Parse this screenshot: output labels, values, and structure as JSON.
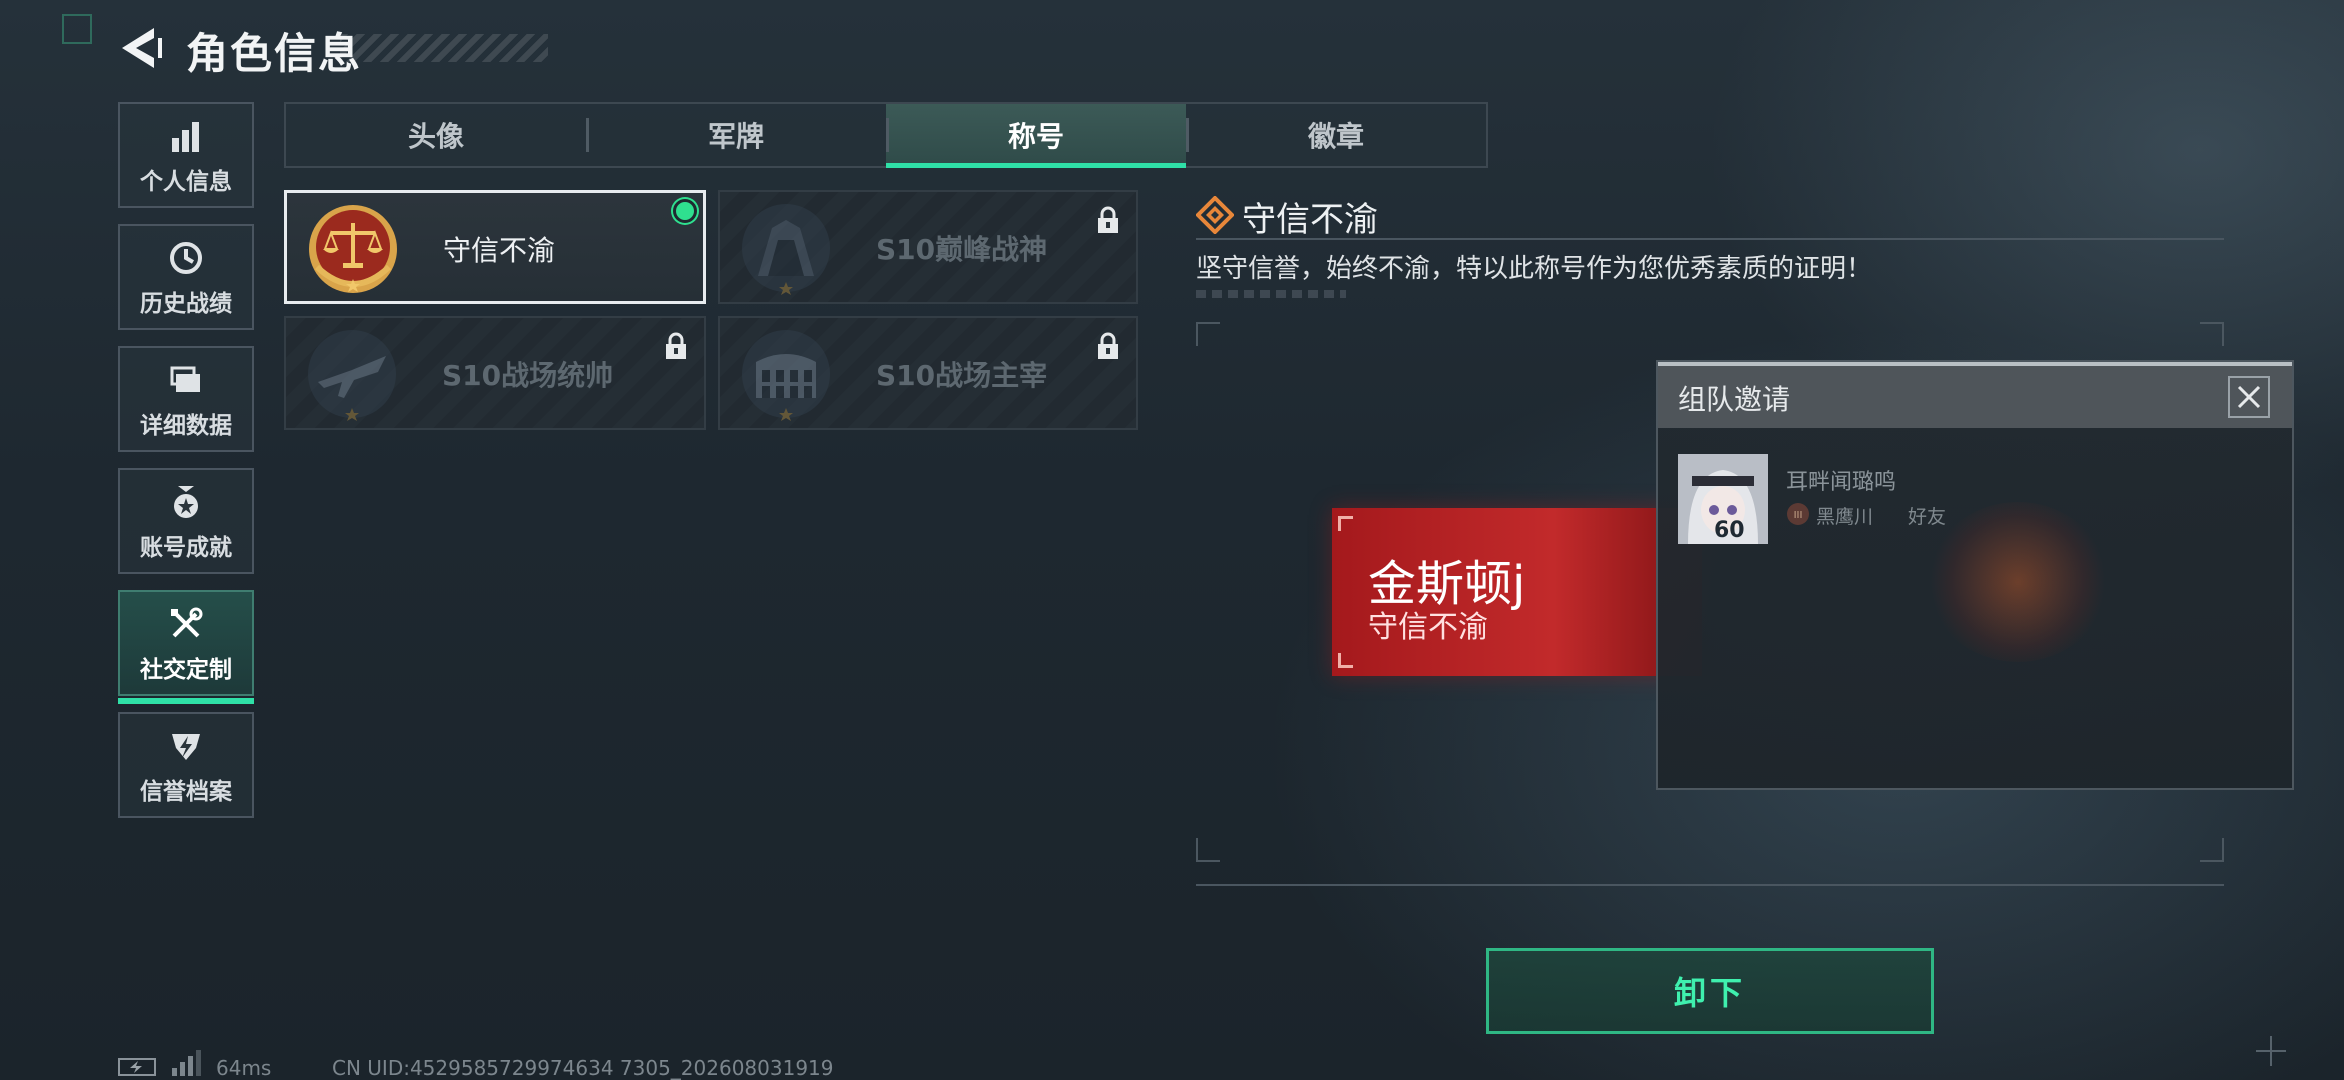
{
  "header": {
    "title": "角色信息"
  },
  "sidebar": {
    "items": [
      {
        "label": "个人信息",
        "icon": "bar-chart-icon"
      },
      {
        "label": "历史战绩",
        "icon": "history-icon"
      },
      {
        "label": "详细数据",
        "icon": "folder-icon"
      },
      {
        "label": "账号成就",
        "icon": "achievement-icon"
      },
      {
        "label": "社交定制",
        "icon": "tools-icon",
        "active": true
      },
      {
        "label": "信誉档案",
        "icon": "reputation-icon"
      }
    ]
  },
  "tabs": [
    {
      "label": "头像"
    },
    {
      "label": "军牌"
    },
    {
      "label": "称号",
      "active": true
    },
    {
      "label": "徽章"
    }
  ],
  "titles": [
    {
      "name": "守信不渝",
      "selected": true,
      "equipped": true,
      "locked": false
    },
    {
      "name": "S10巅峰战神",
      "selected": false,
      "locked": true
    },
    {
      "name": "S10战场统帅",
      "selected": false,
      "locked": true
    },
    {
      "name": "S10战场主宰",
      "selected": false,
      "locked": true
    }
  ],
  "detail": {
    "title": "守信不渝",
    "description": "坚守信誉，始终不渝，特以此称号作为您优秀素质的证明！"
  },
  "nameplate": {
    "player_name": "金斯顿j",
    "title": "守信不渝"
  },
  "action": {
    "unequip_label": "卸下"
  },
  "popup": {
    "title": "组队邀请",
    "friend_name": "耳畔闻璐鸣",
    "guild_name": "黑鹰川",
    "relation": "好友",
    "level": "60"
  },
  "status": {
    "ping": "64ms",
    "uid": "CN UID:4529585729974634 7305_202608031919"
  },
  "colors": {
    "accent": "#2fe0a7",
    "nameplate": "#b82224",
    "medal_gold": "#d9a44a"
  }
}
